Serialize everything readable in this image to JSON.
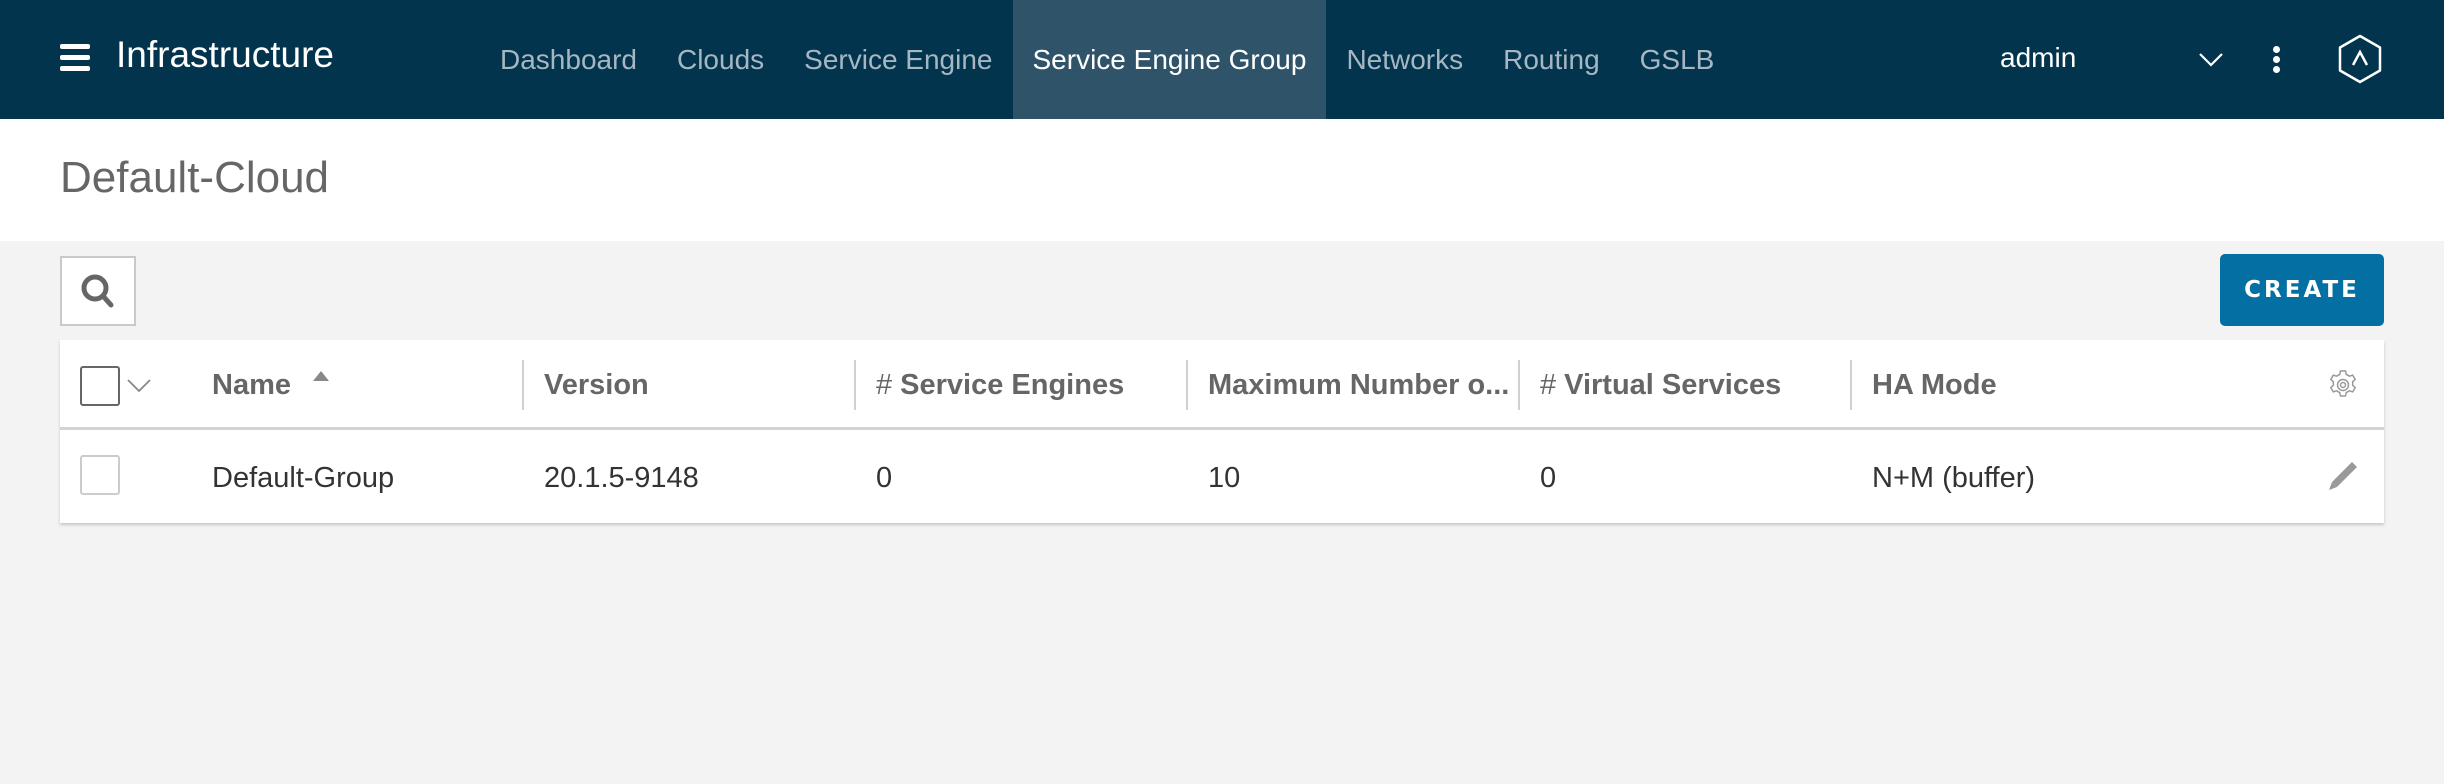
{
  "nav": {
    "menu_icon": "hamburger-menu-icon",
    "app_title": "Infrastructure",
    "tabs": [
      {
        "label": "Dashboard",
        "active": false
      },
      {
        "label": "Clouds",
        "active": false
      },
      {
        "label": "Service Engine",
        "active": false
      },
      {
        "label": "Service Engine Group",
        "active": true
      },
      {
        "label": "Networks",
        "active": false
      },
      {
        "label": "Routing",
        "active": false
      },
      {
        "label": "GSLB",
        "active": false
      }
    ],
    "user": "admin",
    "user_dropdown_icon": "chevron-down-icon",
    "more_icon": "kebab-menu-icon",
    "logo_icon": "hexagon-logo-icon"
  },
  "page": {
    "title": "Default-Cloud"
  },
  "toolbar": {
    "search_icon": "search-icon",
    "create_label": "CREATE"
  },
  "colors": {
    "nav_bg": "#02344e",
    "nav_active_bg": "#2f546a",
    "primary_button": "#036fa3",
    "page_bg": "#f3f3f3"
  },
  "table": {
    "columns": [
      {
        "hash": "",
        "label": "Name",
        "sorted": "asc"
      },
      {
        "hash": "",
        "label": "Version"
      },
      {
        "hash": "#",
        "label": "Service Engines"
      },
      {
        "hash": "",
        "label": "Maximum Number o..."
      },
      {
        "hash": "#",
        "label": "Virtual Services"
      },
      {
        "hash": "",
        "label": "HA Mode"
      }
    ],
    "settings_icon": "gear-icon",
    "rows": [
      {
        "cells": [
          "Default-Group",
          "20.1.5-9148",
          "0",
          "10",
          "0",
          "N+M (buffer)"
        ],
        "checked": false,
        "action_icon": "pencil-edit-icon"
      }
    ]
  }
}
